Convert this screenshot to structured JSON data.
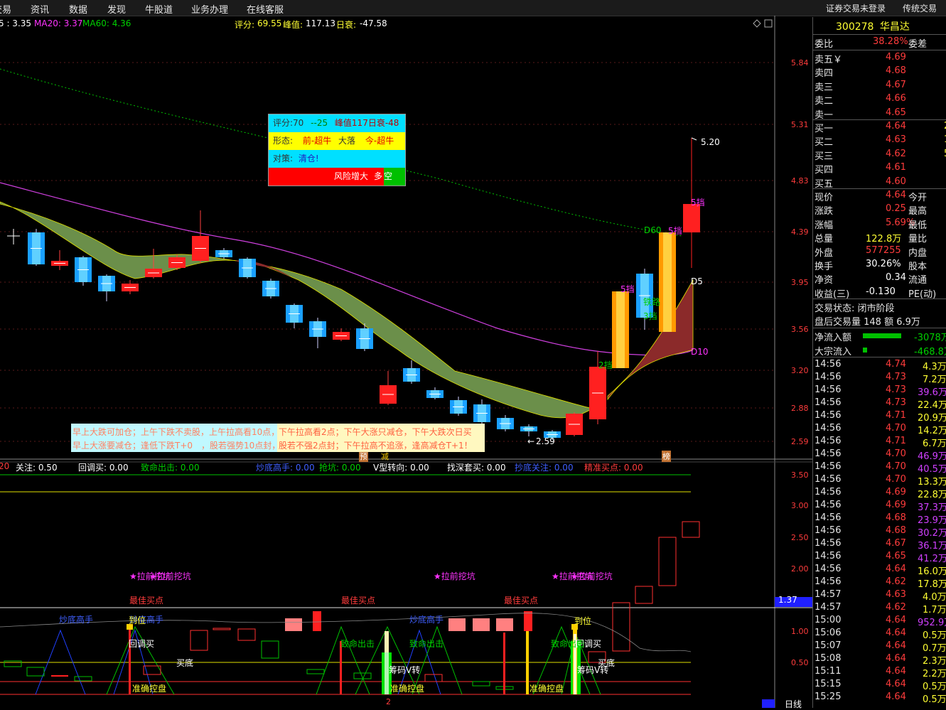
{
  "menu": [
    "交易",
    "资讯",
    "数据",
    "发现",
    "牛股道",
    "业务办理",
    "在线客服"
  ],
  "menu_right": [
    "证券交易未登录",
    "传统交易"
  ],
  "ma_legend": {
    "ma5": "5 : 3.35",
    "ma20": "MA20: 3.37",
    "ma60": "MA60: 4.36",
    "score_label": "评分:",
    "score": "69.55",
    "peak_label": "峰值:",
    "peak": "117.13",
    "decay_label": "日衰:",
    "decay": "-47.58"
  },
  "price_axis": [
    "5.84",
    "5.31",
    "4.83",
    "4.39",
    "3.95",
    "3.56",
    "3.20",
    "2.88",
    "2.59"
  ],
  "ind_axis": [
    "3.50",
    "3.00",
    "2.50",
    "2.00",
    "1.50",
    "1.00",
    "0.50"
  ],
  "current_value_tag": "1.37",
  "chart_marks": {
    "high_label": "5.20",
    "low_label": "2.59",
    "d60": "D60",
    "d5": "D5",
    "d10": "D10",
    "dang5a": "5挡",
    "dang5b": "5挡",
    "dang5c": "5挡",
    "dang2": "2挡",
    "dang3": "3挡",
    "fangxiang": "铁路",
    "yu": "预",
    "jian": "减",
    "bang": "榜"
  },
  "info_box": {
    "score": "评分:70",
    "delta": "--25",
    "peak": "峰值117日衰-48",
    "shape_label": "形态:",
    "shape1": "前-超牛",
    "shape2": "大落",
    "shape3": "今-超牛",
    "strategy_label": "对策:",
    "strategy": "清仓!",
    "risk": "风险增大",
    "duo": "多",
    "kong": "空"
  },
  "advice": {
    "line1a": "早上大跌可加仓；上午下跌不卖股，上午拉高看10点，",
    "line1b": "下午拉高看2点；下午大涨只减仓，下午大跌次日买",
    "line2a": "早上大涨要减仓；逢低下跌T+0　，股若强势10点封，",
    "line2b": "股若不强2点封；下午拉高不追涨，逢高减仓T+1！"
  },
  "indicator_labels": [
    {
      "text": "20",
      "color": "#ff3c3c"
    },
    {
      "text": "关注: 0.50",
      "color": "#ffffff"
    },
    {
      "text": "回调买: 0.00",
      "color": "#ffffff"
    },
    {
      "text": "致命出击: 0.00",
      "color": "#00d000"
    },
    {
      "text": "炒底高手: 0.00",
      "color": "#3f5fff"
    },
    {
      "text": "抢坑: 0.00",
      "color": "#00d000"
    },
    {
      "text": "V型转向: 0.00",
      "color": "#ffffff"
    },
    {
      "text": "找深套买: 0.00",
      "color": "#ffffff"
    },
    {
      "text": "抄底关注: 0.00",
      "color": "#3f5fff"
    },
    {
      "text": "精准买点: 0.00",
      "color": "#ff3c3c"
    }
  ],
  "signals": {
    "lqwk1": "★拉前挖坑",
    "lqwk2": "★拉前挖坑",
    "lqwk3": "★拉前挖坑",
    "jqwk1": "★拉前挖坑",
    "jqwk2": "★拉前挖坑",
    "best1": "最佳买点",
    "best2": "最佳买点",
    "best3": "最佳买点",
    "cdgs1": "炒底高手",
    "cdgs2": "炒底高手",
    "cdgs3": "炒底高手",
    "daowei1": "到位",
    "daowei2": "到位",
    "huidiao1": "回调买",
    "huidiao2": "回调买",
    "zmcj1": "致命出击",
    "zmcj2": "致命出击",
    "zmcj3": "致命出击",
    "maidi1": "买底",
    "maidi2": "买底",
    "chouma1": "筹码V转",
    "chouma2": "筹码V转",
    "kongpan1": "准确控盘",
    "kongpan2": "准确控盘",
    "kongpan3": "准确控盘",
    "bottom_num": "2",
    "period": "日线"
  },
  "stock": {
    "code": "300278",
    "name": "华昌达",
    "weibi_label": "委比",
    "weibi": "38.28%",
    "weicha_label": "委差"
  },
  "asks": [
    {
      "label": "卖五￥",
      "price": "4.69"
    },
    {
      "label": "卖四",
      "price": "4.68"
    },
    {
      "label": "卖三",
      "price": "4.67"
    },
    {
      "label": "卖二",
      "price": "4.66"
    },
    {
      "label": "卖一",
      "price": "4.65"
    }
  ],
  "bids": [
    {
      "label": "买一",
      "price": "4.64",
      "vol": "2"
    },
    {
      "label": "买二",
      "price": "4.63",
      "vol": "1"
    },
    {
      "label": "买三",
      "price": "4.62",
      "vol": "5"
    },
    {
      "label": "买四",
      "price": "4.61",
      "vol": ""
    },
    {
      "label": "买五",
      "price": "4.60",
      "vol": ""
    }
  ],
  "quote": [
    {
      "l1": "现价",
      "v1": "4.64",
      "c1": "red",
      "l2": "今开"
    },
    {
      "l1": "涨跌",
      "v1": "0.25",
      "c1": "red",
      "l2": "最高"
    },
    {
      "l1": "涨幅",
      "v1": "5.69%",
      "c1": "red",
      "l2": "最低"
    },
    {
      "l1": "总量",
      "v1": "122.8万",
      "c1": "yellow",
      "l2": "量比"
    },
    {
      "l1": "外盘",
      "v1": "577255",
      "c1": "red",
      "l2": "内盘"
    },
    {
      "l1": "换手",
      "v1": "30.26%",
      "c1": "white",
      "l2": "股本"
    },
    {
      "l1": "净资",
      "v1": "0.34",
      "c1": "white",
      "l2": "流通"
    },
    {
      "l1": "收益(三)",
      "v1": "-0.130",
      "c1": "white",
      "l2": "PE(动)"
    }
  ],
  "trade_status": "交易状态: 闭市阶段",
  "after_hours": "盘后交易量 148 额 6.9万",
  "flows": [
    {
      "label": "净流入额",
      "value": "-3078万",
      "bar": 0.75
    },
    {
      "label": "大宗流入",
      "value": "-468.8万",
      "bar": 0.08
    }
  ],
  "ticks": [
    {
      "t": "14:56",
      "p": "4.74",
      "v": "4.3万",
      "vc": "#ffff33"
    },
    {
      "t": "14:56",
      "p": "4.73",
      "v": "7.2万",
      "vc": "#ffff33"
    },
    {
      "t": "14:56",
      "p": "4.73",
      "v": "39.6万",
      "vc": "#d040ff"
    },
    {
      "t": "14:56",
      "p": "4.73",
      "v": "22.4万",
      "vc": "#ffff33"
    },
    {
      "t": "14:56",
      "p": "4.71",
      "v": "20.9万",
      "vc": "#ffff33"
    },
    {
      "t": "14:56",
      "p": "4.70",
      "v": "14.2万",
      "vc": "#ffff33"
    },
    {
      "t": "14:56",
      "p": "4.71",
      "v": "6.7万",
      "vc": "#ffff33"
    },
    {
      "t": "14:56",
      "p": "4.70",
      "v": "46.9万",
      "vc": "#d040ff"
    },
    {
      "t": "14:56",
      "p": "4.70",
      "v": "40.5万",
      "vc": "#d040ff"
    },
    {
      "t": "14:56",
      "p": "4.70",
      "v": "13.3万",
      "vc": "#ffff33"
    },
    {
      "t": "14:56",
      "p": "4.69",
      "v": "22.8万",
      "vc": "#ffff33"
    },
    {
      "t": "14:56",
      "p": "4.69",
      "v": "37.3万",
      "vc": "#d040ff"
    },
    {
      "t": "14:56",
      "p": "4.68",
      "v": "23.9万",
      "vc": "#d040ff"
    },
    {
      "t": "14:56",
      "p": "4.68",
      "v": "30.2万",
      "vc": "#d040ff"
    },
    {
      "t": "14:56",
      "p": "4.67",
      "v": "36.1万",
      "vc": "#d040ff"
    },
    {
      "t": "14:56",
      "p": "4.65",
      "v": "41.2万",
      "vc": "#d040ff"
    },
    {
      "t": "14:56",
      "p": "4.64",
      "v": "16.0万",
      "vc": "#ffff33"
    },
    {
      "t": "14:56",
      "p": "4.62",
      "v": "17.8万",
      "vc": "#ffff33"
    },
    {
      "t": "14:57",
      "p": "4.63",
      "v": "4.0万",
      "vc": "#ffff33"
    },
    {
      "t": "14:57",
      "p": "4.62",
      "v": "1.7万",
      "vc": "#ffff33"
    },
    {
      "t": "15:00",
      "p": "4.64",
      "v": "952.9万",
      "vc": "#d040ff"
    },
    {
      "t": "15:06",
      "p": "4.64",
      "v": "0.5万",
      "vc": "#ffff33"
    },
    {
      "t": "15:07",
      "p": "4.64",
      "v": "0.7万",
      "vc": "#ffff33"
    },
    {
      "t": "15:08",
      "p": "4.64",
      "v": "2.3万",
      "vc": "#ffff33"
    },
    {
      "t": "15:11",
      "p": "4.64",
      "v": "2.2万",
      "vc": "#ffff33"
    },
    {
      "t": "15:15",
      "p": "4.64",
      "v": "0.5万",
      "vc": "#ffff33"
    },
    {
      "t": "15:25",
      "p": "4.64",
      "v": "0.5万",
      "vc": "#ffff33"
    }
  ],
  "colors": {
    "up": "#ff2020",
    "down": "#1aa0ff",
    "ma20": "#e040e0",
    "ma60": "#00d000",
    "band_fill": "#6b8f4a",
    "band_red": "#8b2a2a"
  }
}
